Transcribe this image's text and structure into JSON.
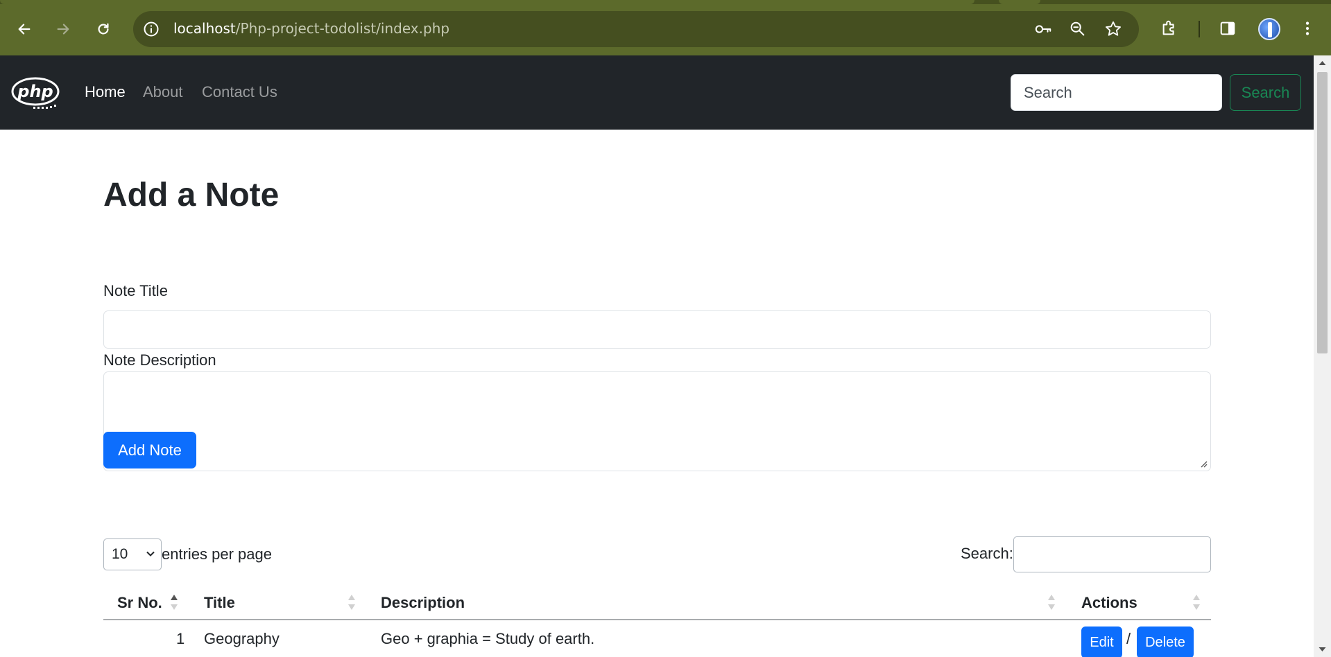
{
  "browser": {
    "url_host": "localhost",
    "url_path": "/Php-project-todolist/index.php",
    "colors": {
      "frame": "#5c6a2b",
      "omnibox": "#454f20"
    },
    "icons": [
      "back-icon",
      "forward-icon",
      "reload-icon",
      "site-info-icon",
      "password-key-icon",
      "zoom-icon",
      "bookmark-star-icon",
      "extensions-icon",
      "side-panel-icon",
      "profile-avatar",
      "menu-icon"
    ]
  },
  "navbar": {
    "brand": "php",
    "links": [
      "Home",
      "About",
      "Contact Us"
    ],
    "active_link": "Home",
    "search_placeholder": "Search",
    "search_button": "Search",
    "colors": {
      "background": "#212529",
      "search_button": "#198754"
    }
  },
  "form": {
    "heading": "Add a Note",
    "title_label": "Note Title",
    "title_value": "",
    "description_label": "Note Description",
    "description_value": "",
    "submit_label": "Add Note",
    "colors": {
      "primary": "#0d6efd"
    }
  },
  "datatable": {
    "page_length": "10",
    "entries_label": "entries per page",
    "search_label": "Search:",
    "search_value": "",
    "columns": [
      "Sr No.",
      "Title",
      "Description",
      "Actions"
    ],
    "rows": [
      {
        "sr_no": "1",
        "title": "Geography",
        "description": "Geo + graphia = Study of earth.",
        "edit_label": "Edit",
        "separator": "/",
        "delete_label": "Delete"
      }
    ]
  }
}
